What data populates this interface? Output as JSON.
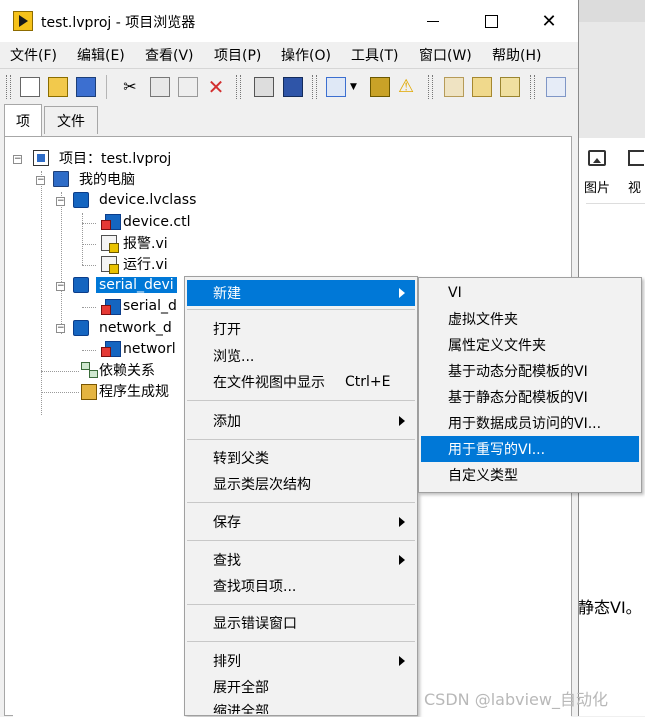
{
  "window": {
    "title": "test.lvproj - 项目浏览器",
    "controls": [
      "minimize",
      "maximize",
      "close"
    ],
    "close_glyph": "✕"
  },
  "menubar": [
    "文件(F)",
    "编辑(E)",
    "查看(V)",
    "项目(P)",
    "操作(O)",
    "工具(T)",
    "窗口(W)",
    "帮助(H)"
  ],
  "tabs": [
    "项",
    "文件"
  ],
  "tree": {
    "project_label": "项目：test.lvproj",
    "my_computer": "我的电脑",
    "class1": "device.lvclass",
    "class1_items": [
      "device.ctl",
      "报警.vi",
      "运行.vi"
    ],
    "class2": "serial_devi",
    "class2_items": [
      "serial_d"
    ],
    "class3": "network_d",
    "class3_items": [
      "networl"
    ],
    "dependencies": "依赖关系",
    "build_specs": "程序生成规"
  },
  "context_menu": {
    "new": "新建",
    "open": "打开",
    "browse": "浏览...",
    "show_in_files": "在文件视图中显示",
    "show_in_files_shortcut": "Ctrl+E",
    "add": "添加",
    "goto_parent": "转到父类",
    "show_hierarchy": "显示类层次结构",
    "save": "保存",
    "find": "查找",
    "find_items": "查找项目项...",
    "show_errors": "显示错误窗口",
    "arrange": "排列",
    "expand_all": "展开全部",
    "collapse_all": "缩进全部"
  },
  "submenu": [
    "VI",
    "虚拟文件夹",
    "属性定义文件夹",
    "基于动态分配模板的VI",
    "基于静态分配模板的VI",
    "用于数据成员访问的VI...",
    "用于重写的VI...",
    "自定义类型"
  ],
  "background_app": {
    "label1": "图片",
    "label2": "视",
    "tail_text": "静态VI。"
  },
  "watermark": "CSDN @labview_自动化",
  "colors": {
    "selection": "#0078d7",
    "menu_bg": "#f2f2f2"
  }
}
